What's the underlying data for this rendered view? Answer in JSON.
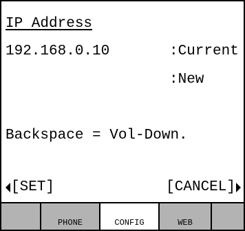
{
  "screen": {
    "title": "IP Address",
    "ip_value": "192.168.0.10",
    "current_label": ":Current",
    "new_label": ":New",
    "hint": "Backspace = Vol-Down."
  },
  "softkeys": {
    "left": "[SET]",
    "right": "[CANCEL]"
  },
  "tabs": [
    {
      "label": "",
      "active": false
    },
    {
      "label": "PHONE",
      "active": false
    },
    {
      "label": "CONFIG",
      "active": true
    },
    {
      "label": "WEB",
      "active": false
    },
    {
      "label": "",
      "active": false
    }
  ],
  "colors": {
    "tab_background": "#b3b3b3",
    "active_tab": "#ffffff"
  }
}
